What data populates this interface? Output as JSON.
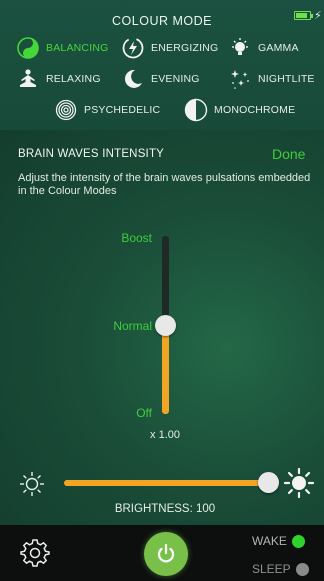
{
  "header": {
    "title": "COLOUR MODE",
    "battery_level": 0.75
  },
  "modes": [
    {
      "label": "BALANCING",
      "icon": "yin-yang-icon",
      "active": true
    },
    {
      "label": "ENERGIZING",
      "icon": "energy-swirl-icon",
      "active": false
    },
    {
      "label": "GAMMA",
      "icon": "bulb-icon",
      "active": false
    },
    {
      "label": "RELAXING",
      "icon": "meditation-icon",
      "active": false
    },
    {
      "label": "EVENING",
      "icon": "moon-icon",
      "active": false
    },
    {
      "label": "NIGHTLITE",
      "icon": "stars-icon",
      "active": false
    },
    {
      "label": "PSYCHEDELIC",
      "icon": "spiral-icon",
      "active": false
    },
    {
      "label": "MONOCHROME",
      "icon": "half-circle-icon",
      "active": false
    }
  ],
  "intensity": {
    "title": "BRAIN WAVES INTENSITY",
    "done_label": "Done",
    "description": "Adjust the intensity of the brain waves pulsations embedded in the Colour Modes",
    "levels": {
      "boost": "Boost",
      "normal": "Normal",
      "off": "Off"
    },
    "value_fraction": 0.5,
    "multiplier": "x 1.00"
  },
  "brightness": {
    "label": "BRIGHTNESS: 100",
    "value": 100
  },
  "footer": {
    "wake_label": "WAKE",
    "sleep_label": "SLEEP"
  },
  "colors": {
    "accent": "#3fcc3a",
    "slider": "#f2a524",
    "power": "#79c04a",
    "wake_dot": "#2fd12c",
    "sleep_dot": "#8a8a8a"
  }
}
